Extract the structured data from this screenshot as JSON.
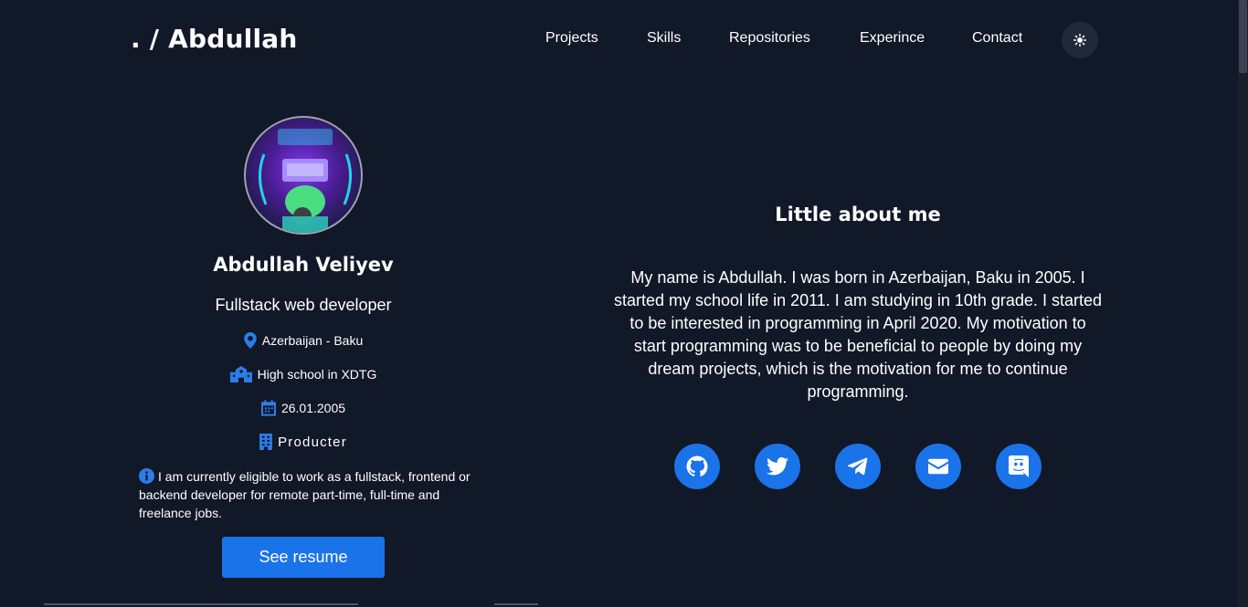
{
  "header": {
    "logo": ". / Abdullah",
    "nav": [
      "Projects",
      "Skills",
      "Repositories",
      "Experince",
      "Contact"
    ]
  },
  "profile": {
    "name": "Abdullah Veliyev",
    "role": "Fullstack web developer",
    "location": "Azerbaijan - Baku",
    "school": "High school in XDTG",
    "birthdate": "26.01.2005",
    "company": "Producter",
    "note": "I am currently eligible to work as a fullstack, frontend or backend developer for remote part-time, full-time and freelance jobs.",
    "resume_label": "See resume"
  },
  "about": {
    "title": "Little about me",
    "text": "My name is Abdullah. I was born in Azerbaijan, Baku in 2005. I started my school life in 2011. I am studying in 10th grade. I started to be interested in programming in April 2020. My motivation to start programming was to be beneficial to people by doing my dream projects, which is the motivation for me to continue programming."
  },
  "social": [
    "github-icon",
    "twitter-icon",
    "telegram-icon",
    "mail-icon",
    "discord-icon"
  ],
  "colors": {
    "background": "#111827",
    "accent": "#1a73e8",
    "icon_accent": "#2b7de9"
  }
}
